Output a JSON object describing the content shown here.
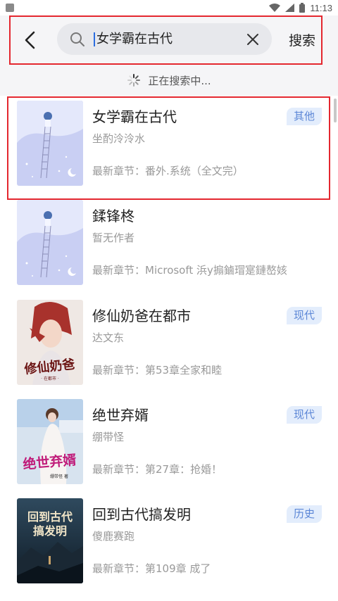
{
  "status_bar": {
    "time": "11:13"
  },
  "search": {
    "query": "女学霸在古代",
    "submit_label": "搜索"
  },
  "loading": {
    "text": "正在搜索中..."
  },
  "books": [
    {
      "title": "女学霸在古代",
      "author": "坐酌泠泠水",
      "latest": "最新章节：番外.系统（全文完）",
      "category": "其他",
      "cover": "lavender-girl-ladder"
    },
    {
      "title": "鍒锋柊",
      "author": "暂无作者",
      "latest": "最新章节：Microsoft 浜у搧鏀瑁寔鏈嶅姟",
      "category": "",
      "cover": "lavender-girl-ladder"
    },
    {
      "title": "修仙奶爸在都市",
      "author": "达文东",
      "latest": "最新章节：第53章全家和睦",
      "category": "现代",
      "cover": "red-haired-man"
    },
    {
      "title": "绝世弃婿",
      "author": "绷带怪",
      "latest": "最新章节：第27章：抢婚！",
      "category": "现代",
      "cover": "white-dress-girl"
    },
    {
      "title": "回到古代搞发明",
      "author": "傻鹿赛跑",
      "latest": "最新章节：第109章 成了",
      "category": "历史",
      "cover": "dark-mountain"
    }
  ],
  "colors": {
    "accent": "#5b86d6",
    "tag_bg": "#e3edfc",
    "highlight": "#e4272f",
    "header_bg": "#f5f5f7"
  }
}
